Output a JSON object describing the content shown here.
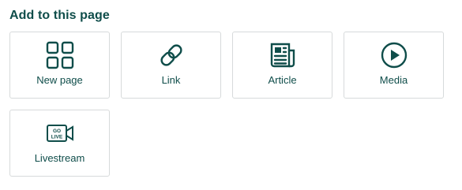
{
  "title": "Add to this page",
  "accent_color": "#0f4d4a",
  "tiles": [
    {
      "label": "New page",
      "icon": "grid-four-squares-icon"
    },
    {
      "label": "Link",
      "icon": "chain-link-icon"
    },
    {
      "label": "Article",
      "icon": "newspaper-icon"
    },
    {
      "label": "Media",
      "icon": "play-circle-icon"
    },
    {
      "label": "Livestream",
      "icon": "go-live-camera-icon",
      "icon_text": [
        "GO",
        "LIVE"
      ]
    }
  ]
}
